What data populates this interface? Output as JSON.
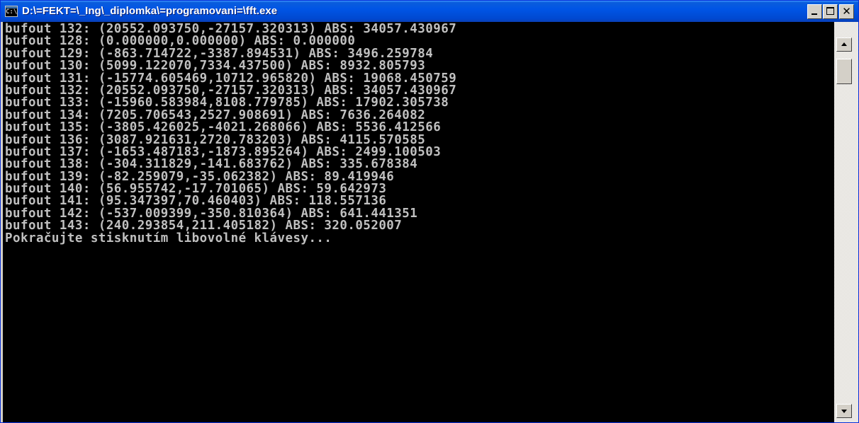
{
  "window": {
    "title": "D:\\=FEKT=\\_Ing\\_diplomka\\=programovani=\\fft.exe",
    "icon": "console-icon",
    "icon_text": "C:\\",
    "controls": {
      "minimize": "minimize-icon",
      "maximize": "maximize-icon",
      "close_glyph": "✕"
    }
  },
  "console": {
    "text_color": "#c0c0c0",
    "background": "#000000",
    "lines": [
      "bufout 132: (20552.093750,-27157.320313) ABS: 34057.430967",
      "bufout 128: (0.000000,0.000000) ABS: 0.000000",
      "bufout 129: (-863.714722,-3387.894531) ABS: 3496.259784",
      "bufout 130: (5099.122070,7334.437500) ABS: 8932.805793",
      "bufout 131: (-15774.605469,10712.965820) ABS: 19068.450759",
      "bufout 132: (20552.093750,-27157.320313) ABS: 34057.430967",
      "bufout 133: (-15960.583984,8108.779785) ABS: 17902.305738",
      "bufout 134: (7205.706543,2527.908691) ABS: 7636.264082",
      "bufout 135: (-3805.426025,-4021.268066) ABS: 5536.412566",
      "bufout 136: (3087.921631,2720.783203) ABS: 4115.570585",
      "bufout 137: (-1653.487183,-1873.895264) ABS: 2499.100503",
      "bufout 138: (-304.311829,-141.683762) ABS: 335.678384",
      "bufout 139: (-82.259079,-35.062382) ABS: 89.419946",
      "bufout 140: (56.955742,-17.701065) ABS: 59.642973",
      "bufout 141: (95.347397,70.460403) ABS: 118.557136",
      "bufout 142: (-537.009399,-350.810364) ABS: 641.441351",
      "bufout 143: (240.293854,211.405182) ABS: 320.052007",
      "Pokračujte stisknutím libovolné klávesy..."
    ]
  },
  "scrollbar": {
    "up_icon": "arrow-up-icon",
    "down_icon": "arrow-down-icon"
  }
}
